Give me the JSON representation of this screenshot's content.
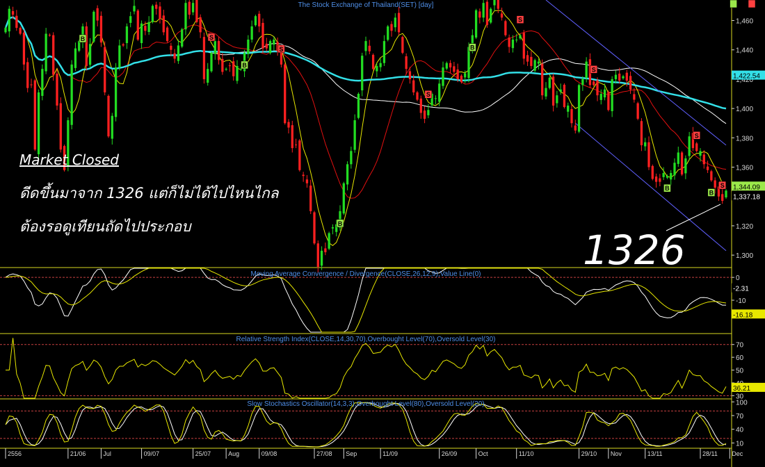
{
  "chart_data": [
    {
      "type": "candlestick",
      "title": "The Stock Exchange of Thailand(SET) [day]",
      "ylim": [
        1292,
        1474
      ],
      "yticks": [
        1300,
        1320,
        1340,
        1360,
        1380,
        1400,
        1420,
        1440,
        1460
      ],
      "ytick_labels": [
        "1,300",
        "1,320",
        "1,340",
        "1,360",
        "1,380",
        "1,400",
        "1,420",
        "1,440",
        "1,460"
      ],
      "x_labels": [
        "2556",
        "21/06",
        "Jul",
        "09/07",
        "25/07",
        "Aug",
        "09/08",
        "27/08",
        "Sep",
        "11/09",
        "26/09",
        "Oct",
        "11/10",
        "29/10",
        "Nov",
        "13/11",
        "28/11",
        "Dec"
      ],
      "x_label_index": [
        0,
        17,
        26,
        37,
        51,
        60,
        69,
        84,
        92,
        102,
        118,
        128,
        139,
        156,
        164,
        174,
        189,
        197
      ],
      "closes": [
        1455,
        1468,
        1464,
        1455,
        1451,
        1430,
        1414,
        1416,
        1372,
        1411,
        1427,
        1451,
        1450,
        1423,
        1402,
        1372,
        1358,
        1392,
        1430,
        1441,
        1446,
        1456,
        1429,
        1444,
        1466,
        1460,
        1445,
        1411,
        1381,
        1395,
        1428,
        1443,
        1443,
        1456,
        1463,
        1470,
        1447,
        1458,
        1453,
        1459,
        1470,
        1468,
        1461,
        1452,
        1446,
        1440,
        1434,
        1443,
        1454,
        1472,
        1464,
        1472,
        1459,
        1452,
        1420,
        1427,
        1438,
        1446,
        1433,
        1425,
        1427,
        1429,
        1422,
        1429,
        1427,
        1438,
        1447,
        1456,
        1463,
        1456,
        1441,
        1441,
        1446,
        1447,
        1439,
        1430,
        1390,
        1387,
        1373,
        1375,
        1358,
        1354,
        1349,
        1330,
        1308,
        1292,
        1303,
        1302,
        1315,
        1319,
        1321,
        1330,
        1349,
        1362,
        1371,
        1392,
        1410,
        1436,
        1446,
        1439,
        1427,
        1429,
        1431,
        1446,
        1456,
        1453,
        1462,
        1452,
        1438,
        1427,
        1420,
        1411,
        1406,
        1397,
        1393,
        1399,
        1410,
        1407,
        1417,
        1428,
        1431,
        1428,
        1425,
        1420,
        1418,
        1424,
        1442,
        1450,
        1467,
        1462,
        1472,
        1457,
        1468,
        1474,
        1468,
        1462,
        1450,
        1442,
        1447,
        1447,
        1450,
        1434,
        1432,
        1429,
        1433,
        1432,
        1409,
        1414,
        1421,
        1402,
        1409,
        1413,
        1401,
        1402,
        1390,
        1385,
        1416,
        1420,
        1432,
        1416,
        1416,
        1409,
        1410,
        1413,
        1399,
        1420,
        1423,
        1419,
        1422,
        1419,
        1413,
        1406,
        1393,
        1375,
        1377,
        1360,
        1352,
        1350,
        1350,
        1356,
        1354,
        1356,
        1363,
        1370,
        1355,
        1366,
        1381,
        1373,
        1371,
        1371,
        1362,
        1358,
        1351,
        1346,
        1340,
        1337,
        1344
      ],
      "last_values": [
        "1,344.09",
        "1,337.18"
      ],
      "ma_value": "1,422.54",
      "ma_value_y": 1422.54,
      "signals": [
        {
          "index": 21,
          "label": "B",
          "type": "buy"
        },
        {
          "index": 56,
          "label": "S",
          "type": "sell"
        },
        {
          "index": 65,
          "label": "B",
          "type": "buy"
        },
        {
          "index": 75,
          "label": "S",
          "type": "sell"
        },
        {
          "index": 91,
          "label": "B",
          "type": "buy"
        },
        {
          "index": 115,
          "label": "S",
          "type": "sell"
        },
        {
          "index": 127,
          "label": "B",
          "type": "buy"
        },
        {
          "index": 140,
          "label": "S",
          "type": "sell"
        },
        {
          "index": 160,
          "label": "S",
          "type": "sell"
        },
        {
          "index": 180,
          "label": "B",
          "type": "buy"
        },
        {
          "index": 188,
          "label": "S",
          "type": "sell"
        },
        {
          "index": 192,
          "label": "B",
          "type": "buy"
        },
        {
          "index": 195,
          "label": "S",
          "type": "sell"
        },
        {
          "index": 198,
          "label": "B",
          "type": "buy"
        },
        {
          "index": 203,
          "label": "S",
          "type": "sell"
        }
      ],
      "colors": {
        "up": "#22dd22",
        "down": "#ff2020",
        "ma_fast": "#e8e800",
        "ma_mid": "#e01010",
        "ma_slow": "#ffffff",
        "ma_long": "#33e0e8",
        "channel": "#6060ff"
      }
    },
    {
      "type": "line",
      "title": "Moving Average Convergence / Divergence(CLOSE,26,12,9),Value Line(0)",
      "ylim": [
        -24,
        4
      ],
      "yticks": [
        0,
        -10
      ],
      "ytick_labels": [
        "0",
        "-10"
      ],
      "zero_line": 0,
      "last_values": [
        "-2.31",
        "-16.18"
      ],
      "series": [
        {
          "name": "MACD",
          "color": "#ffffff"
        },
        {
          "name": "Signal",
          "color": "#e8e800"
        }
      ]
    },
    {
      "type": "line",
      "title": "Relative Strength Index(CLOSE,14,30,70),Overbought Level(70),Oversold Level(30)",
      "ylim": [
        28,
        78
      ],
      "yticks": [
        30,
        40,
        50,
        60,
        70
      ],
      "ytick_labels": [
        "30",
        "40",
        "50",
        "60",
        "70"
      ],
      "levels": [
        70,
        30
      ],
      "last_value": "36.21",
      "series": [
        {
          "name": "RSI",
          "color": "#e8e800"
        }
      ]
    },
    {
      "type": "line",
      "title": "Slow Stochastics Oscillator(14,3,3),Overbought Level(80),Oversold Level(20)",
      "ylim": [
        0,
        105
      ],
      "yticks": [
        10,
        40,
        70,
        100
      ],
      "ytick_labels": [
        "10",
        "40",
        "70",
        "100"
      ],
      "levels": [
        80,
        20
      ],
      "series": [
        {
          "name": "%K",
          "color": "#e8e800"
        },
        {
          "name": "%D",
          "color": "#ffffff"
        }
      ]
    }
  ],
  "annotations": {
    "title": "Market Closed",
    "line1": "ดีดขึ้นมาจาก 1326 แต่ก็ไม่ได้ไปไหนไกล",
    "line2": "ต้องรอดูเทียนถัดไปประกอบ",
    "big_label": "1326"
  }
}
